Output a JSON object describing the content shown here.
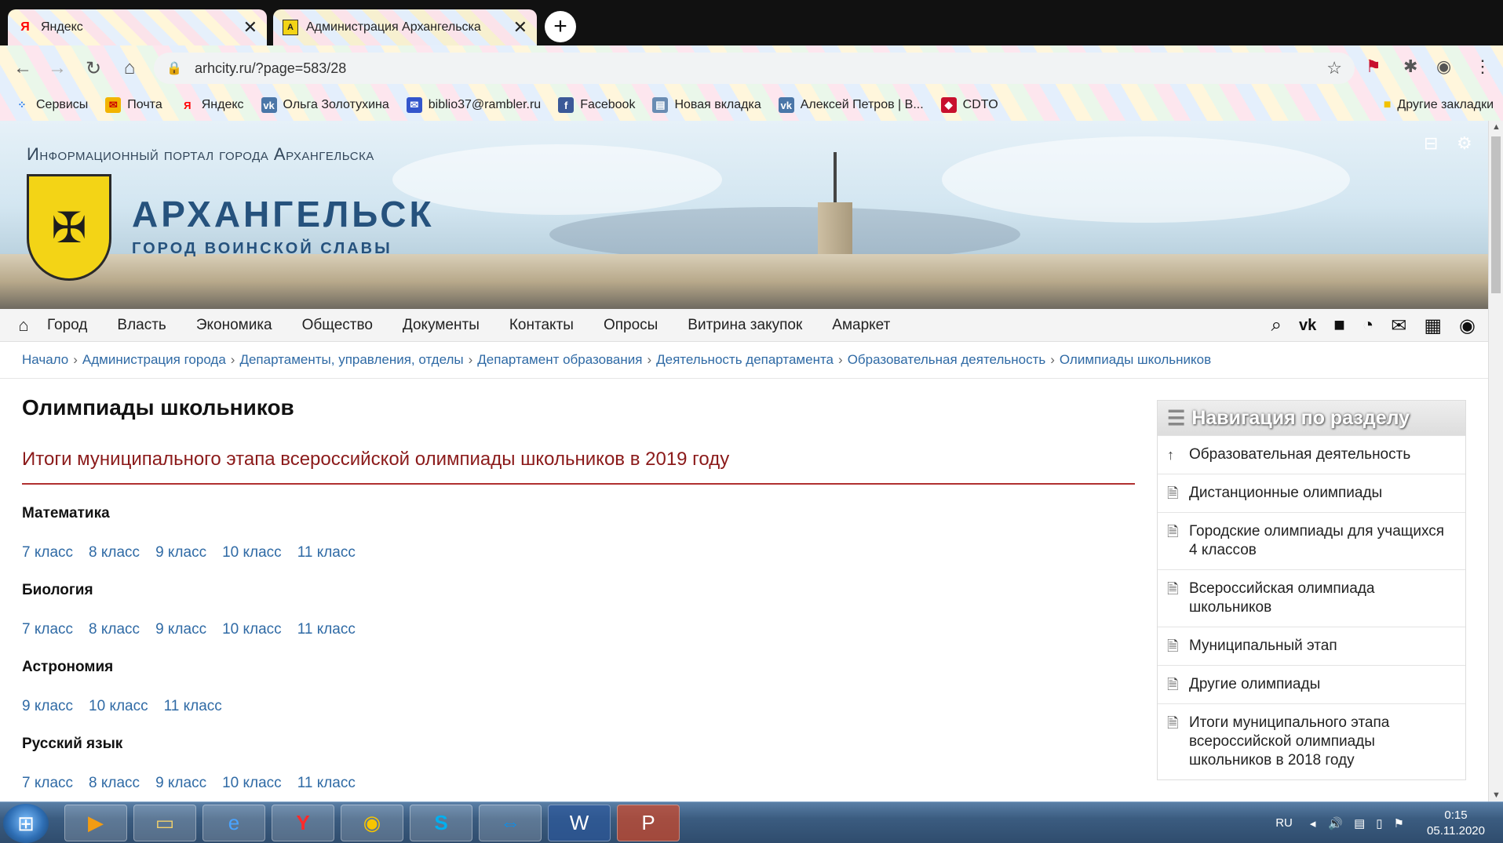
{
  "browser": {
    "tabs": [
      {
        "title": "Яндекс",
        "favicon": "Я",
        "active": false
      },
      {
        "title": "Администрация Архангельска",
        "favicon": "А",
        "active": true
      }
    ],
    "new_tab_icon": "plus-icon",
    "url": "arhcity.ru/?page=583/28",
    "bookmarks": [
      {
        "label": "Сервисы",
        "icon": "apps-icon",
        "color": "#1a73e8"
      },
      {
        "label": "Почта",
        "icon": "mail-icon",
        "color": "#f2b400"
      },
      {
        "label": "Яндекс",
        "icon": "yandex-icon",
        "color": "#ff0000"
      },
      {
        "label": "Ольга Золотухина",
        "icon": "vk-icon",
        "color": "#4a76a8"
      },
      {
        "label": "biblio37@rambler.ru",
        "icon": "envelope-icon",
        "color": "#3355cc"
      },
      {
        "label": "Facebook",
        "icon": "facebook-icon",
        "color": "#3b5998"
      },
      {
        "label": "Новая вкладка",
        "icon": "page-icon",
        "color": "#6a8cb3"
      },
      {
        "label": "Алексей Петров | В...",
        "icon": "vk-icon",
        "color": "#4a76a8"
      },
      {
        "label": "CDTO",
        "icon": "cdto-icon",
        "color": "#c8102e"
      }
    ],
    "other_bookmarks": "Другие закладки"
  },
  "header": {
    "portal_title": "Информационный портал города Архангельска",
    "city_name": "АРХАНГЕЛЬСК",
    "city_subtitle": "ГОРОД ВОИНСКОЙ СЛАВЫ"
  },
  "mainnav": {
    "items": [
      "Город",
      "Власть",
      "Экономика",
      "Общество",
      "Документы",
      "Контакты",
      "Опросы",
      "Витрина закупок",
      "Амаркет"
    ]
  },
  "breadcrumbs": [
    "Начало",
    "Администрация города",
    "Департаменты, управления, отделы",
    "Департамент образования",
    "Деятельность департамента",
    "Образовательная деятельность",
    "Олимпиады школьников"
  ],
  "main": {
    "title": "Олимпиады школьников",
    "subtitle": "Итоги муниципального этапа всероссийской олимпиады школьников в 2019 году",
    "subjects": [
      {
        "name": "Математика",
        "grades": [
          "7 класс",
          "8 класс",
          "9 класс",
          "10 класс",
          "11 класс"
        ]
      },
      {
        "name": "Биология",
        "grades": [
          "7 класс",
          "8 класс",
          "9 класс",
          "10 класс",
          "11 класс"
        ]
      },
      {
        "name": "Астрономия",
        "grades": [
          "9 класс",
          "10 класс",
          "11 класс"
        ]
      },
      {
        "name": "Русский язык",
        "grades": [
          "7 класс",
          "8 класс",
          "9 класс",
          "10 класс",
          "11 класс"
        ]
      }
    ]
  },
  "sidebar": {
    "heading": "Навигация по разделу",
    "items": [
      {
        "label": "Образовательная деятельность",
        "icon": "arrow-up-icon"
      },
      {
        "label": "Дистанционные олимпиады",
        "icon": "document-icon"
      },
      {
        "label": "Городские олимпиады для учащихся 4 классов",
        "icon": "document-icon"
      },
      {
        "label": "Всероссийская олимпиада школьников",
        "icon": "document-icon"
      },
      {
        "label": "Муниципальный этап",
        "icon": "document-icon"
      },
      {
        "label": "Другие олимпиады",
        "icon": "document-icon"
      },
      {
        "label": "Итоги муниципального этапа всероссийской олимпиады школьников в 2018 году",
        "icon": "document-icon"
      }
    ]
  },
  "taskbar": {
    "language": "RU",
    "time": "0:15",
    "date": "05.11.2020"
  },
  "colors": {
    "link": "#2f6aa5",
    "subtitle": "#8b1a1a",
    "city_name": "#26527d"
  }
}
